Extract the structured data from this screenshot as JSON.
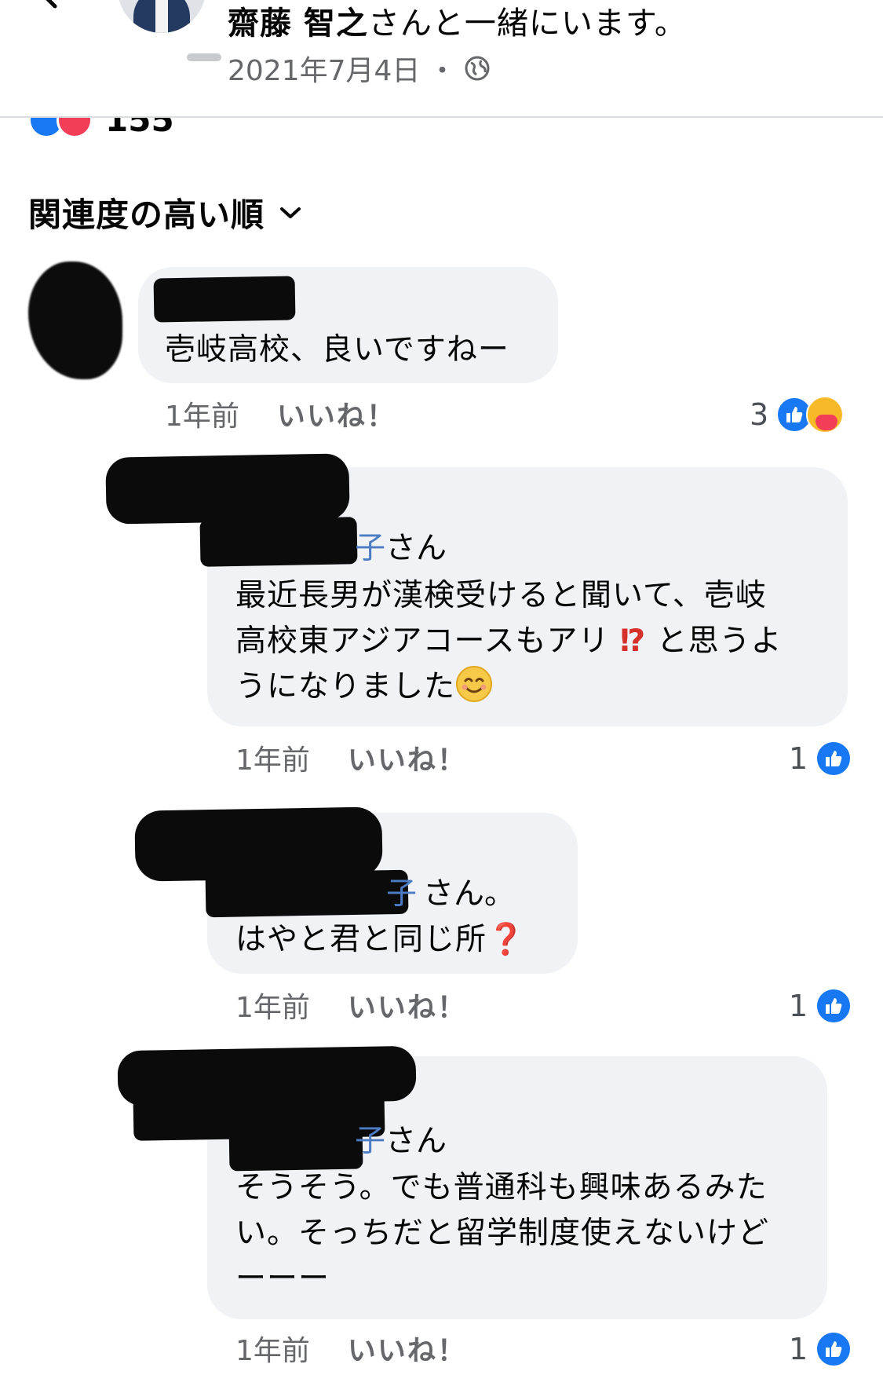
{
  "header": {
    "tagged_name": "齋藤 智之",
    "with_suffix": "さんと一緒にいます。",
    "date": "2021年7月4日",
    "separator": "・",
    "privacy_icon": "globe-icon"
  },
  "reactions": {
    "icons": [
      "like-icon",
      "love-icon"
    ],
    "count": "155"
  },
  "sort": {
    "label": "関連度の高い順",
    "icon": "chevron-down-icon"
  },
  "comments": [
    {
      "text": "壱岐高校、良いですねー",
      "time": "1年前",
      "like_label": "いいね！",
      "reaction_count": "3",
      "reaction_icons": [
        "like-icon",
        "care-icon"
      ]
    },
    {
      "mention_tail_blue": "子",
      "mention_suffix": "さん",
      "text_line1": "最近長男が漢検受けると聞いて、壱岐",
      "text_line2a": "高校東アジアコースもアリ",
      "text_line2_mark": "⁉",
      "text_line2b": "と思うよ",
      "text_line3": "うになりました",
      "time": "1年前",
      "like_label": "いいね！",
      "reaction_count": "1",
      "reaction_icons": [
        "like-icon"
      ]
    },
    {
      "mention_tail_blue": "子",
      "mention_suffix": "さん。",
      "text_a": "はやと君と同じ所",
      "text_mark": "❓",
      "time": "1年前",
      "like_label": "いいね！",
      "reaction_count": "1",
      "reaction_icons": [
        "like-icon"
      ]
    },
    {
      "mention_tail_blue": "子",
      "mention_suffix": "さん",
      "text_line1": "そうそう。でも普通科も興味あるみた",
      "text_line2": "い。そっちだと留学制度使えないけど",
      "text_line3": "ーーー",
      "time": "1年前",
      "like_label": "いいね！",
      "reaction_count": "1",
      "reaction_icons": [
        "like-icon"
      ]
    }
  ],
  "colors": {
    "like_blue": "#1877f2",
    "love_red": "#f33e58",
    "bubble_gray": "#f0f2f5",
    "meta_gray": "#65676b",
    "mention_blue": "#4c7cc3"
  }
}
